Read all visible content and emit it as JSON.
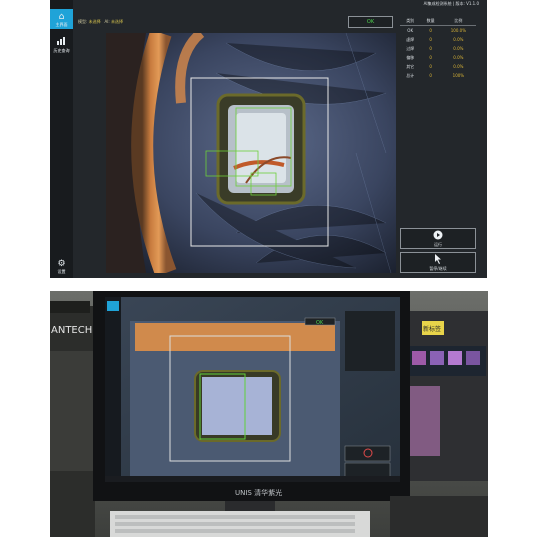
{
  "sidebar": {
    "items": [
      {
        "label": "主界面",
        "icon": "home-icon"
      },
      {
        "label": "历史查询",
        "icon": "chart-icon"
      },
      {
        "label": "设置",
        "icon": "gear-icon"
      }
    ]
  },
  "titlebar": {
    "title": "AI集成检测系统 | 版本: V1.1.0"
  },
  "labels": {
    "model_label": "模型:",
    "model_value": "未选择",
    "ai_label": "AI:",
    "ai_value": "未选择"
  },
  "ok_label": "OK",
  "stats": {
    "headers": [
      "类别",
      "数量",
      "比例"
    ],
    "rows": [
      {
        "name": "OK",
        "count": "0",
        "ratio": "100.0%"
      },
      {
        "name": "虚焊",
        "count": "0",
        "ratio": "0.0%"
      },
      {
        "name": "过焊",
        "count": "0",
        "ratio": "0.0%"
      },
      {
        "name": "偏移",
        "count": "0",
        "ratio": "0.0%"
      },
      {
        "name": "其它",
        "count": "0",
        "ratio": "0.0%"
      },
      {
        "name": "总计",
        "count": "0",
        "ratio": "100%"
      }
    ]
  },
  "buttons": {
    "run_label": "运行",
    "pause_label": "暂停/继续"
  },
  "photo": {
    "ok_label": "OK",
    "monitor_brand": "UNIS 清华紫光",
    "left_brand": "ANTECH",
    "sticker_text": "新标签"
  },
  "colors": {
    "accent": "#1fa3d8",
    "ok_green": "#4fd24f",
    "value_yellow": "#d9b437"
  }
}
